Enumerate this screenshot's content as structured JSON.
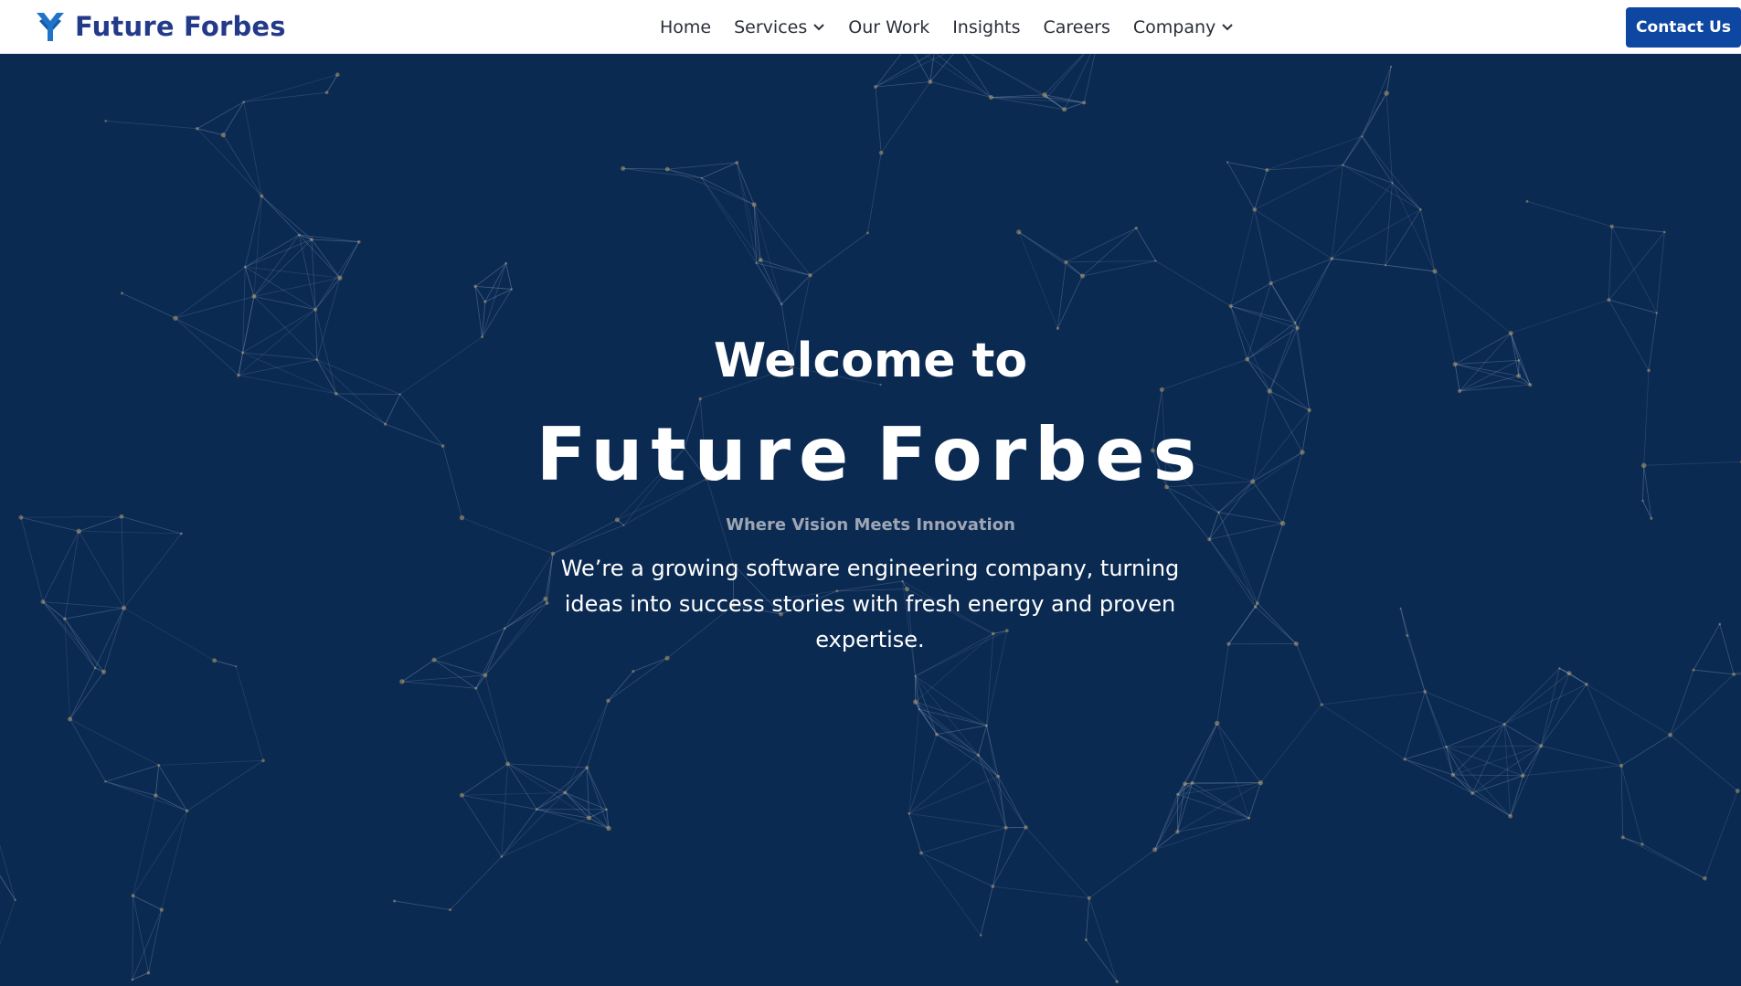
{
  "brand": {
    "name": "Future Forbes",
    "logo_icon": "future-forbes-logo-icon",
    "color": "#233a8a"
  },
  "nav": {
    "items": [
      {
        "label": "Home",
        "dropdown": false
      },
      {
        "label": "Services",
        "dropdown": true
      },
      {
        "label": "Our Work",
        "dropdown": false
      },
      {
        "label": "Insights",
        "dropdown": false
      },
      {
        "label": "Careers",
        "dropdown": false
      },
      {
        "label": "Company",
        "dropdown": true
      }
    ],
    "contact_label": "Contact Us",
    "contact_color": "#0d47a1"
  },
  "hero": {
    "welcome": "Welcome to",
    "brand_word_1": "Future",
    "brand_word_2": "Forbes",
    "tagline": "Where Vision Meets Innovation",
    "description": "We’re a growing software engineering company, turning ideas into success stories with fresh energy and proven expertise.",
    "background_color": "#0b2a52",
    "network_line_color": "#8fa5c4",
    "network_node_color": "#d9b36c"
  }
}
